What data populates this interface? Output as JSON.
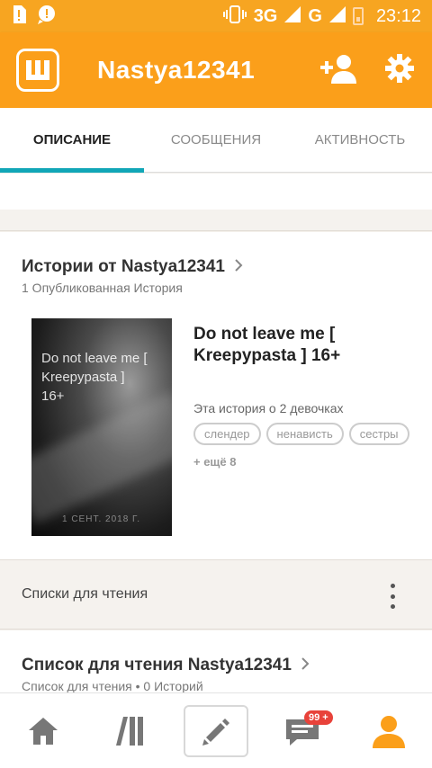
{
  "status_bar": {
    "network_3g": "3G",
    "network_g": "G",
    "time": "23:12"
  },
  "app_bar": {
    "title": "Nastya12341",
    "logo_icon": "wattpad-logo-icon",
    "add_friend_icon": "add-person-icon",
    "settings_icon": "gear-icon",
    "accent_color": "#fb9f1a"
  },
  "tabs": [
    {
      "label": "ОПИСАНИЕ",
      "active": true
    },
    {
      "label": "СООБЩЕНИЯ",
      "active": false
    },
    {
      "label": "АКТИВНОСТЬ",
      "active": false
    }
  ],
  "stories": {
    "title": "Истории от Nastya12341",
    "subtitle": "1 Опубликованная История",
    "item": {
      "cover_text": "Do not leave me [ Kreepypasta ] 16+",
      "cover_stamp": "1 СЕНТ. 2018 Г.",
      "title": "Do not leave me [ Kreepypasta ]  16+",
      "description": "Эта история о 2 девочках",
      "tags": [
        "слендер",
        "ненависть",
        "сестры"
      ],
      "more_tags": "+ ещё 8"
    }
  },
  "reading_lists": {
    "header": "Списки для чтения",
    "list_title": "Список для чтения Nastya12341",
    "list_subtitle": "Список для чтения • 0 Историй"
  },
  "bottom_nav": {
    "items": [
      {
        "icon": "home-icon"
      },
      {
        "icon": "library-icon"
      },
      {
        "icon": "pencil-icon"
      },
      {
        "icon": "messages-icon",
        "badge": "99 +"
      },
      {
        "icon": "profile-icon"
      }
    ],
    "active_color": "#fb9f1a"
  }
}
